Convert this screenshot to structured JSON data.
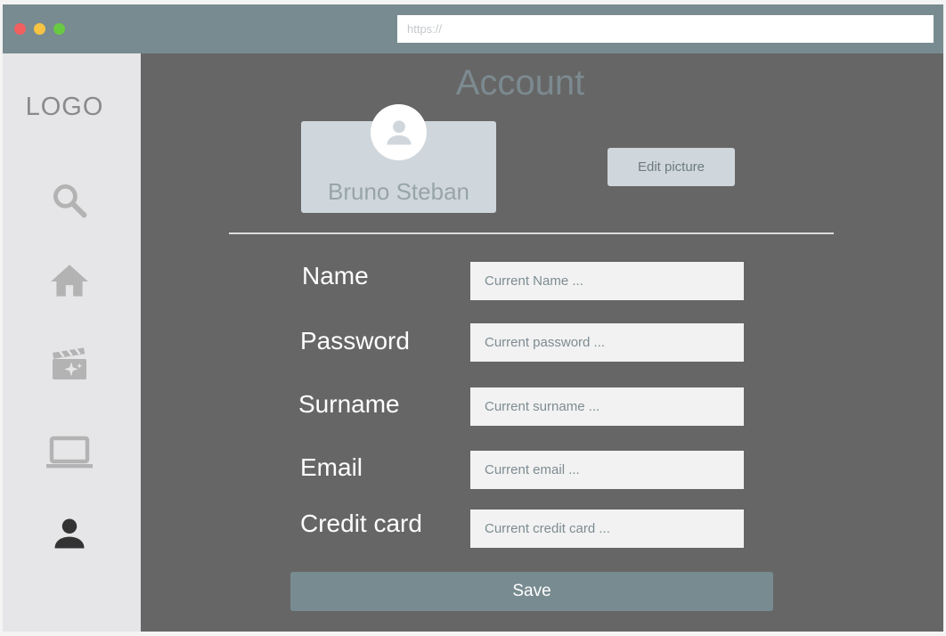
{
  "browser": {
    "url_placeholder": "https://"
  },
  "sidebar": {
    "logo": "LOGO",
    "items": [
      {
        "icon": "search-icon"
      },
      {
        "icon": "home-icon"
      },
      {
        "icon": "movie-icon"
      },
      {
        "icon": "laptop-icon"
      },
      {
        "icon": "user-icon",
        "active": true
      }
    ]
  },
  "page": {
    "title": "Account"
  },
  "profile": {
    "name": "Bruno Steban",
    "edit_picture_label": "Edit picture"
  },
  "form": {
    "fields": [
      {
        "label": "Name",
        "placeholder": "Current Name ..."
      },
      {
        "label": "Password",
        "placeholder": "Current password ..."
      },
      {
        "label": "Surname",
        "placeholder": "Current surname ..."
      },
      {
        "label": "Email",
        "placeholder": "Current email ..."
      },
      {
        "label": "Credit card",
        "placeholder": "Current credit card ..."
      }
    ],
    "save_label": "Save"
  },
  "colors": {
    "titlebar": "#788b90",
    "content_bg": "#666666",
    "sidebar_bg": "#e6e6e8",
    "card_bg": "#cfd7dc",
    "icon_inactive": "#b3b3b3",
    "icon_active": "#333333"
  }
}
